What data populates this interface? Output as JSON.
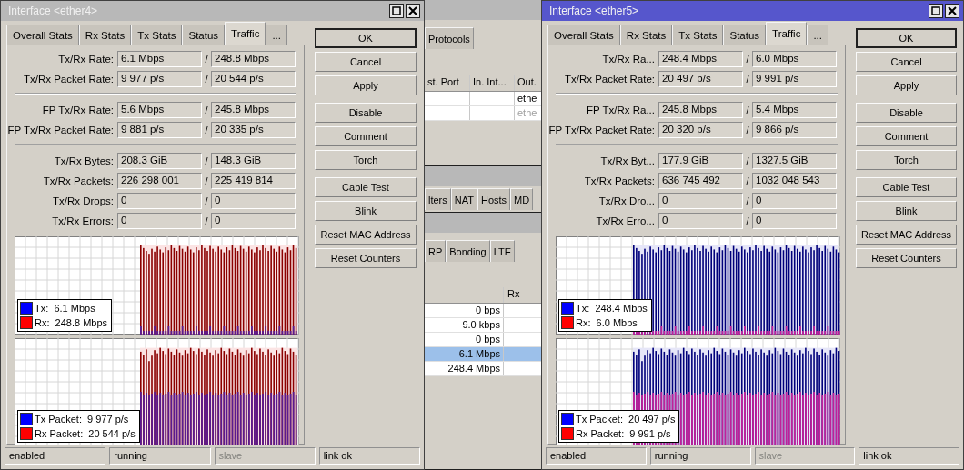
{
  "windows": [
    {
      "title": "Interface <ether4>",
      "active": false,
      "tabs": [
        {
          "label": "Overall Stats",
          "selected": false
        },
        {
          "label": "Rx Stats",
          "selected": false
        },
        {
          "label": "Tx Stats",
          "selected": false
        },
        {
          "label": "Status",
          "selected": false
        },
        {
          "label": "Traffic",
          "selected": true
        },
        {
          "label": "...",
          "selected": false
        }
      ],
      "field_groups": [
        [
          {
            "label": "Tx/Rx Rate:",
            "tx": "6.1 Mbps",
            "sep": "/",
            "rx": "248.8 Mbps"
          },
          {
            "label": "Tx/Rx Packet Rate:",
            "tx": "9 977 p/s",
            "sep": "/",
            "rx": "20 544 p/s"
          }
        ],
        [
          {
            "label": "FP Tx/Rx Rate:",
            "tx": "5.6 Mbps",
            "sep": "/",
            "rx": "245.8 Mbps"
          },
          {
            "label": "FP Tx/Rx Packet Rate:",
            "tx": "9 881 p/s",
            "sep": "/",
            "rx": "20 335 p/s"
          }
        ],
        [
          {
            "label": "Tx/Rx Bytes:",
            "tx": "208.3 GiB",
            "sep": "/",
            "rx": "148.3 GiB"
          },
          {
            "label": "Tx/Rx Packets:",
            "tx": "226 298 001",
            "sep": "/",
            "rx": "225 419 814"
          },
          {
            "label": "Tx/Rx Drops:",
            "tx": "0",
            "sep": "/",
            "rx": "0"
          },
          {
            "label": "Tx/Rx Errors:",
            "tx": "0",
            "sep": "/",
            "rx": "0"
          }
        ]
      ],
      "graphs": [
        {
          "kind": "rx-rate",
          "legend": [
            {
              "text": "Tx:  6.1 Mbps",
              "color": "#0000ff"
            },
            {
              "text": "Rx:  248.8 Mbps",
              "color": "#ff0000"
            }
          ]
        },
        {
          "kind": "rx-packet",
          "legend": [
            {
              "text": "Tx Packet:  9 977 p/s",
              "color": "#0000ff"
            },
            {
              "text": "Rx Packet:  20 544 p/s",
              "color": "#ff0000"
            }
          ]
        }
      ],
      "button_groups": [
        [
          {
            "label": "OK",
            "default": true
          },
          {
            "label": "Cancel",
            "default": false
          },
          {
            "label": "Apply",
            "default": false
          }
        ],
        [
          {
            "label": "Disable",
            "default": false
          },
          {
            "label": "Comment",
            "default": false
          },
          {
            "label": "Torch",
            "default": false
          }
        ],
        [
          {
            "label": "Cable Test",
            "default": false
          },
          {
            "label": "Blink",
            "default": false
          },
          {
            "label": "Reset MAC Address",
            "default": false
          },
          {
            "label": "Reset Counters",
            "default": false
          }
        ]
      ],
      "status": [
        {
          "text": "enabled",
          "disabled": false
        },
        {
          "text": "running",
          "disabled": false
        },
        {
          "text": "slave",
          "disabled": true
        },
        {
          "text": "link ok",
          "disabled": false
        }
      ]
    },
    {
      "title": "Interface <ether5>",
      "active": true,
      "tabs": [
        {
          "label": "Overall Stats",
          "selected": false
        },
        {
          "label": "Rx Stats",
          "selected": false
        },
        {
          "label": "Tx Stats",
          "selected": false
        },
        {
          "label": "Status",
          "selected": false
        },
        {
          "label": "Traffic",
          "selected": true
        },
        {
          "label": "...",
          "selected": false
        }
      ],
      "field_groups": [
        [
          {
            "label": "Tx/Rx Ra...",
            "tx": "248.4 Mbps",
            "sep": "/",
            "rx": "6.0 Mbps"
          },
          {
            "label": "Tx/Rx Packet Rate:",
            "tx": "20 497 p/s",
            "sep": "/",
            "rx": "9 991 p/s"
          }
        ],
        [
          {
            "label": "FP Tx/Rx Ra...",
            "tx": "245.8 Mbps",
            "sep": "/",
            "rx": "5.4 Mbps"
          },
          {
            "label": "FP Tx/Rx Packet Rate:",
            "tx": "20 320 p/s",
            "sep": "/",
            "rx": "9 866 p/s"
          }
        ],
        [
          {
            "label": "Tx/Rx Byt...",
            "tx": "177.9 GiB",
            "sep": "/",
            "rx": "1327.5 GiB"
          },
          {
            "label": "Tx/Rx Packets:",
            "tx": "636 745 492",
            "sep": "/",
            "rx": "1032 048 543"
          },
          {
            "label": "Tx/Rx Dro...",
            "tx": "0",
            "sep": "/",
            "rx": "0"
          },
          {
            "label": "Tx/Rx Erro...",
            "tx": "0",
            "sep": "/",
            "rx": "0"
          }
        ]
      ],
      "graphs": [
        {
          "kind": "tx-rate",
          "legend": [
            {
              "text": "Tx:  248.4 Mbps",
              "color": "#0000ff"
            },
            {
              "text": "Rx:  6.0 Mbps",
              "color": "#ff0000"
            }
          ]
        },
        {
          "kind": "tx-packet",
          "legend": [
            {
              "text": "Tx Packet:  20 497 p/s",
              "color": "#0000ff"
            },
            {
              "text": "Rx Packet:  9 991 p/s",
              "color": "#ff0000"
            }
          ]
        }
      ],
      "button_groups": [
        [
          {
            "label": "OK",
            "default": true
          },
          {
            "label": "Cancel",
            "default": false
          },
          {
            "label": "Apply",
            "default": false
          }
        ],
        [
          {
            "label": "Disable",
            "default": false
          },
          {
            "label": "Comment",
            "default": false
          },
          {
            "label": "Torch",
            "default": false
          }
        ],
        [
          {
            "label": "Cable Test",
            "default": false
          },
          {
            "label": "Blink",
            "default": false
          },
          {
            "label": "Reset MAC Address",
            "default": false
          },
          {
            "label": "Reset Counters",
            "default": false
          }
        ]
      ],
      "status": [
        {
          "text": "enabled",
          "disabled": false
        },
        {
          "text": "running",
          "disabled": false
        },
        {
          "text": "slave",
          "disabled": true
        },
        {
          "text": "link ok",
          "disabled": false
        }
      ]
    }
  ],
  "background": {
    "panels": [
      {
        "tabs": [
          "Protocols"
        ],
        "table": {
          "columns": [
            "st. Port",
            "In. Int...",
            "Out."
          ],
          "rows": [
            {
              "out": "ethe",
              "disabled": false
            },
            {
              "out": "ethe",
              "disabled": true
            }
          ]
        }
      },
      {
        "tabs": [
          "lters",
          "NAT",
          "Hosts",
          "MD"
        ]
      },
      {
        "tabs": [
          "RP",
          "Bonding",
          "LTE"
        ],
        "rate_table": {
          "columns": [
            "Rx"
          ],
          "rows": [
            {
              "value": "0 bps",
              "selected": false
            },
            {
              "value": "9.0 kbps",
              "selected": false
            },
            {
              "value": "0 bps",
              "selected": false
            },
            {
              "value": "6.1 Mbps",
              "selected": true
            },
            {
              "value": "248.4 Mbps",
              "selected": false
            }
          ]
        }
      }
    ]
  }
}
